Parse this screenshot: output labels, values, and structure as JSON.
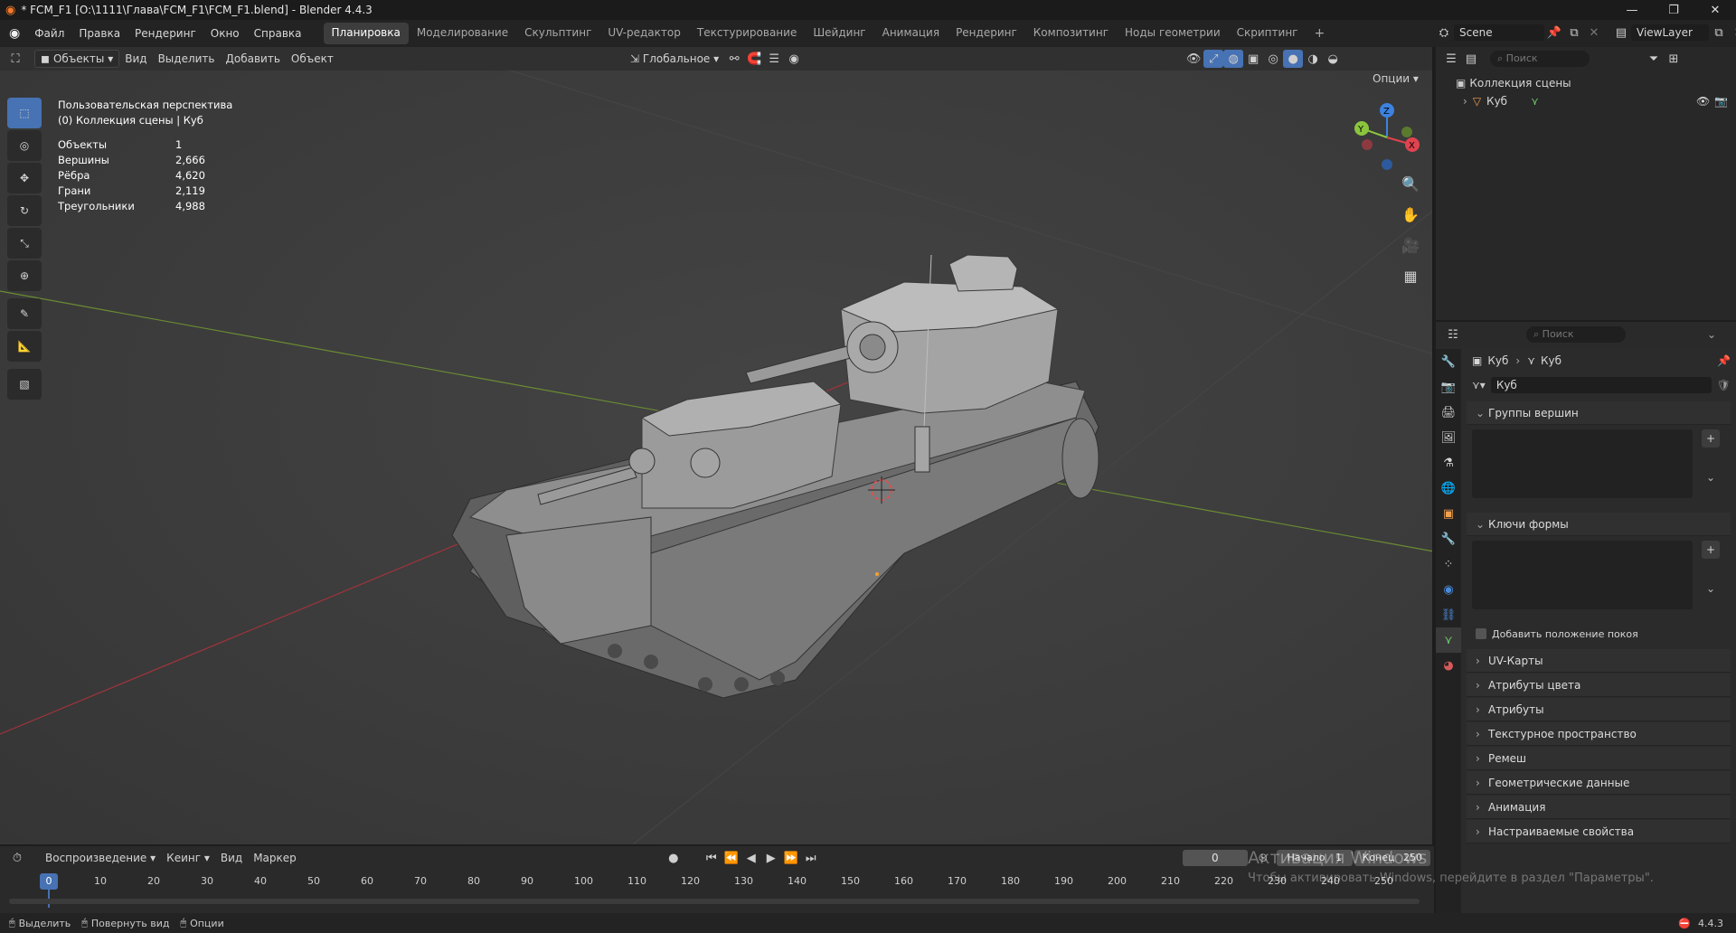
{
  "window": {
    "title": "* FCM_F1 [O:\\1111\\Глава\\FCM_F1\\FCM_F1.blend] - Blender 4.4.3",
    "minimize": "—",
    "maximize": "❐",
    "close": "✕"
  },
  "menu": {
    "items": [
      "Файл",
      "Правка",
      "Рендеринг",
      "Окно",
      "Справка"
    ],
    "tabs": [
      "Планировка",
      "Моделирование",
      "Скульптинг",
      "UV-редактор",
      "Текстурирование",
      "Шейдинг",
      "Анимация",
      "Рендеринг",
      "Композитинг",
      "Ноды геометрии",
      "Скриптинг"
    ],
    "add_tab": "+",
    "scene": "Scene",
    "view_layer": "ViewLayer"
  },
  "viewport_header": {
    "mode": "Объекты",
    "view": "Вид",
    "select": "Выделить",
    "add": "Добавить",
    "object": "Объект",
    "orientation": "Глобальное",
    "options": "Опции"
  },
  "overlay": {
    "view_name": "Пользовательская перспектива",
    "collection": "(0) Коллекция сцены | Куб",
    "stats": [
      {
        "label": "Объекты",
        "value": "1"
      },
      {
        "label": "Вершины",
        "value": "2,666"
      },
      {
        "label": "Рёбра",
        "value": "4,620"
      },
      {
        "label": "Грани",
        "value": "2,119"
      },
      {
        "label": "Треугольники",
        "value": "4,988"
      }
    ]
  },
  "gizmo": {
    "x": "X",
    "y": "Y",
    "z": "Z"
  },
  "outliner": {
    "search_placeholder": "Поиск",
    "collection": "Коллекция сцены",
    "object": "Куб"
  },
  "properties": {
    "search_placeholder": "Поиск",
    "breadcrumb_object": "Куб",
    "breadcrumb_data": "Куб",
    "mesh_name": "Куб",
    "vertex_groups": "Группы вершин",
    "shape_keys": "Ключи формы",
    "add_rest_position": "Добавить положение покоя",
    "panels": [
      "UV-Карты",
      "Атрибуты цвета",
      "Атрибуты",
      "Текстурное пространство",
      "Ремеш",
      "Геометрические данные",
      "Анимация",
      "Настраиваемые свойства"
    ]
  },
  "timeline": {
    "playback": "Воспроизведение",
    "keying": "Кеинг",
    "view": "Вид",
    "marker": "Маркер",
    "current_frame": "0",
    "start_label": "Начало",
    "start": "1",
    "end_label": "Конец",
    "end": "250",
    "frame_marker": "0",
    "ruler": [
      "10",
      "20",
      "30",
      "40",
      "50",
      "60",
      "70",
      "80",
      "90",
      "100",
      "110",
      "120",
      "130",
      "140",
      "150",
      "160",
      "170",
      "180",
      "190",
      "200",
      "210",
      "220",
      "230",
      "240",
      "250"
    ]
  },
  "status": {
    "select": "Выделить",
    "rotate": "Повернуть вид",
    "options": "Опции",
    "version": "4.4.3"
  },
  "watermark": {
    "line1": "Активация Windows",
    "line2": "Чтобы активировать Windows, перейдите в раздел \"Параметры\"."
  },
  "colors": {
    "accent": "#4772b3",
    "x_axis": "#e0434f",
    "y_axis": "#8bc53d",
    "z_axis": "#3c82e0",
    "viewport_bg": "#3d3d3d"
  }
}
